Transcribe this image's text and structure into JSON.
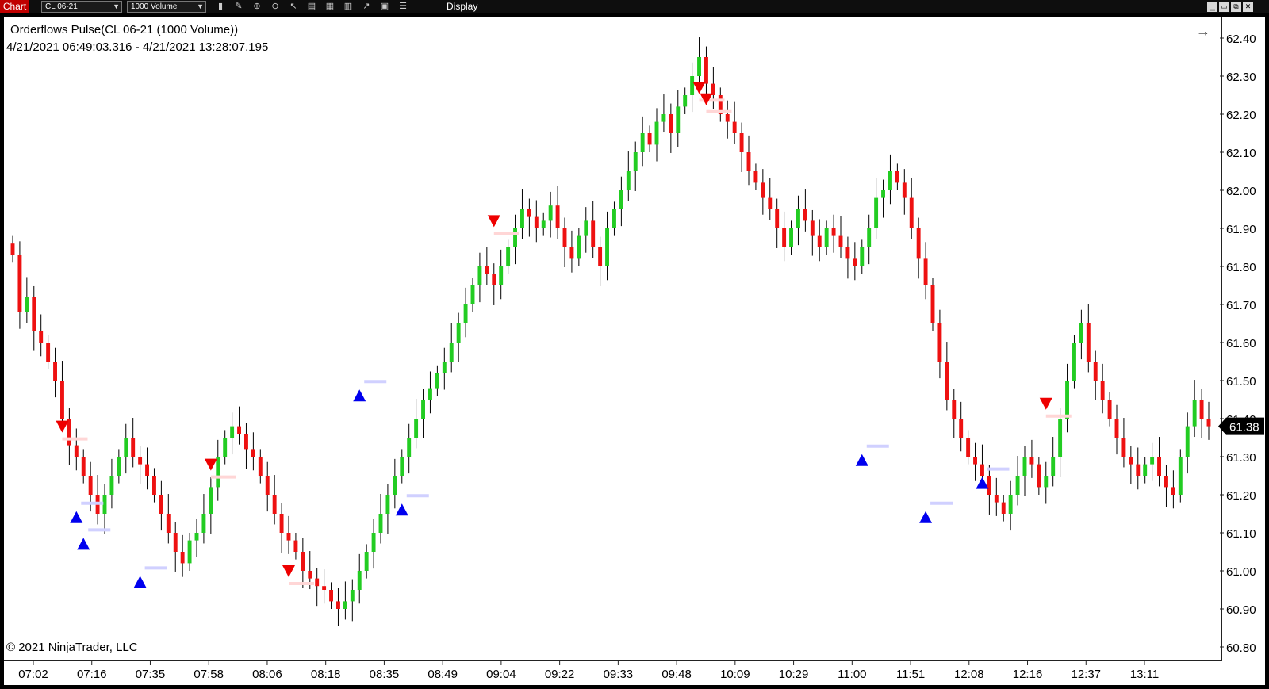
{
  "toolbar": {
    "tab_label": "Chart",
    "instrument": "CL 06-21",
    "period": "1000 Volume",
    "display_label": "Display",
    "icons": [
      "bar-style-icon",
      "drawing-tool-icon",
      "zoom-in-icon",
      "zoom-out-icon",
      "pointer-icon",
      "data-box-icon",
      "templates-icon",
      "indicators-icon",
      "strategies-icon",
      "properties-icon"
    ]
  },
  "chart": {
    "title": "Orderflows Pulse(CL 06-21 (1000 Volume))",
    "range": "4/21/2021 06:49:03.316 - 4/21/2021 13:28:07.195",
    "copyright": "© 2021 NinjaTrader, LLC",
    "arrow_icon": "→",
    "current_price": "61.38",
    "colors": {
      "up": "#22cc22",
      "down": "#ee1111",
      "wick": "#000000",
      "buy_marker": "#0000ee",
      "sell_marker": "#ee0000",
      "price_tag": "#000000"
    }
  },
  "chart_data": {
    "type": "candlestick",
    "ylim": [
      60.8,
      62.4
    ],
    "y_ticks": [
      "62.40",
      "62.30",
      "62.20",
      "62.10",
      "62.00",
      "61.90",
      "61.80",
      "61.70",
      "61.60",
      "61.50",
      "61.40",
      "61.30",
      "61.20",
      "61.10",
      "61.00",
      "60.90",
      "60.80"
    ],
    "x_ticks": [
      "07:02",
      "07:16",
      "07:35",
      "07:58",
      "08:06",
      "08:18",
      "08:35",
      "08:49",
      "09:04",
      "09:22",
      "09:33",
      "09:48",
      "10:09",
      "10:29",
      "11:00",
      "11:51",
      "12:08",
      "12:16",
      "12:37",
      "13:11"
    ],
    "closes": [
      61.83,
      61.68,
      61.72,
      61.63,
      61.6,
      61.55,
      61.5,
      61.4,
      61.33,
      61.3,
      61.25,
      61.2,
      61.15,
      61.2,
      61.25,
      61.3,
      61.35,
      61.3,
      61.28,
      61.25,
      61.2,
      61.15,
      61.1,
      61.05,
      61.02,
      61.08,
      61.1,
      61.15,
      61.22,
      61.3,
      61.35,
      61.38,
      61.36,
      61.32,
      61.3,
      61.25,
      61.2,
      61.15,
      61.1,
      61.08,
      61.05,
      61.0,
      60.98,
      60.96,
      60.95,
      60.92,
      60.9,
      60.92,
      60.95,
      61.0,
      61.05,
      61.1,
      61.15,
      61.2,
      61.25,
      61.3,
      61.35,
      61.4,
      61.45,
      61.48,
      61.52,
      61.55,
      61.6,
      61.65,
      61.7,
      61.75,
      61.8,
      61.78,
      61.75,
      61.8,
      61.85,
      61.9,
      61.95,
      61.93,
      61.9,
      61.92,
      61.96,
      61.9,
      61.85,
      61.82,
      61.88,
      61.92,
      61.85,
      61.8,
      61.9,
      61.95,
      62.0,
      62.05,
      62.1,
      62.15,
      62.12,
      62.18,
      62.2,
      62.15,
      62.22,
      62.25,
      62.3,
      62.35,
      62.28,
      62.25,
      62.2,
      62.18,
      62.15,
      62.1,
      62.05,
      62.02,
      61.98,
      61.95,
      61.9,
      61.85,
      61.9,
      61.95,
      61.92,
      61.88,
      61.85,
      61.9,
      61.88,
      61.85,
      61.82,
      61.8,
      61.85,
      61.9,
      61.98,
      62.0,
      62.05,
      62.02,
      61.98,
      61.9,
      61.82,
      61.75,
      61.65,
      61.55,
      61.45,
      61.4,
      61.35,
      61.3,
      61.28,
      61.25,
      61.2,
      61.18,
      61.15,
      61.2,
      61.25,
      61.3,
      61.28,
      61.22,
      61.25,
      61.3,
      61.4,
      61.5,
      61.6,
      61.65,
      61.55,
      61.5,
      61.45,
      61.4,
      61.35,
      61.3,
      61.28,
      61.25,
      61.28,
      61.3,
      61.25,
      61.22,
      61.2,
      61.3,
      61.38,
      61.45,
      61.4,
      61.38
    ],
    "buy_markers": [
      61.14,
      61.07,
      60.97,
      61.16,
      61.46,
      61.29,
      61.14,
      61.23
    ],
    "sell_markers": [
      61.38,
      61.28,
      61.0,
      61.92,
      62.27,
      62.24,
      61.44
    ]
  }
}
